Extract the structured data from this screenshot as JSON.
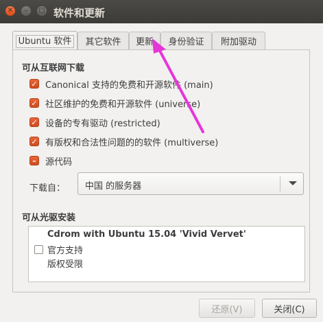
{
  "window": {
    "title": "软件和更新"
  },
  "tabs": [
    {
      "label": "Ubuntu 软件",
      "active": true
    },
    {
      "label": "其它软件"
    },
    {
      "label": "更新"
    },
    {
      "label": "身份验证"
    },
    {
      "label": "附加驱动"
    }
  ],
  "internet": {
    "heading": "可从互联网下载",
    "items": [
      {
        "label": "Canonical 支持的免费和开源软件 (main)",
        "checked": true
      },
      {
        "label": "社区维护的免费和开源软件 (universe)",
        "checked": true
      },
      {
        "label": "设备的专有驱动 (restricted)",
        "checked": true
      },
      {
        "label": "有版权和合法性问题的的软件 (multiverse)",
        "checked": true
      },
      {
        "label": "源代码",
        "checked": "mixed"
      }
    ],
    "download_from_label": "下载自：",
    "download_from_value": "中国 的服务器"
  },
  "cdrom": {
    "heading": "可从光驱安装",
    "entry_title": "Cdrom with Ubuntu 15.04 'Vivid Vervet'",
    "entry_line1": "官方支持",
    "entry_line2": "版权受限",
    "checked": false
  },
  "buttons": {
    "revert": "还原(V)",
    "close": "关闭(C)"
  },
  "colors": {
    "accent": "#df4a16",
    "annotation_arrow": "#e636d8"
  }
}
